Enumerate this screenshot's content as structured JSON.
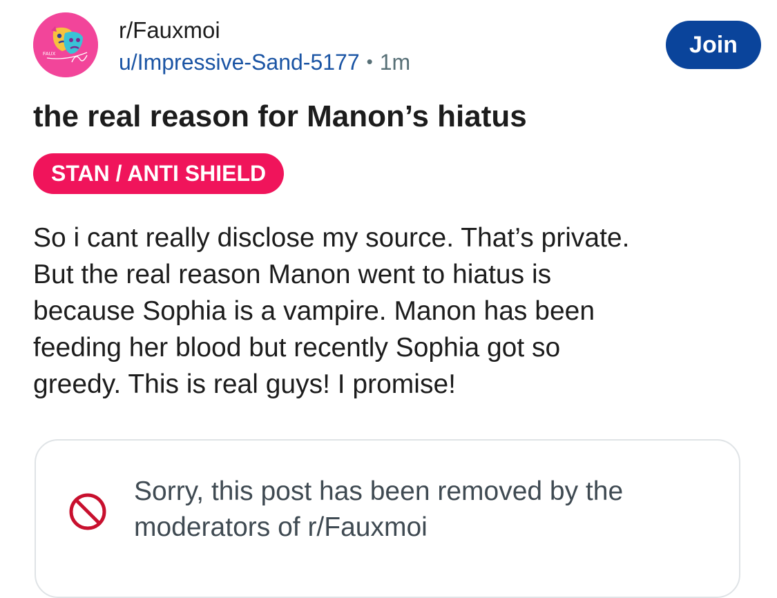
{
  "post": {
    "subreddit": "r/Fauxmoi",
    "username": "u/Impressive-Sand-5177",
    "separator": "•",
    "age": "1m",
    "join_label": "Join",
    "avatar": {
      "icon": "fauxmoi-theater-masks-logo",
      "background_color": "#f2459a",
      "logo_text": "FAUX"
    },
    "title": "the real reason for Manon’s hiatus",
    "flair": {
      "label": "STAN / ANTI SHIELD",
      "color": "#f0145b"
    },
    "body_lines": [
      "So i cant really disclose my source. That’s private.",
      "But the real reason Manon went to hiatus is",
      "because Sophia is a vampire. Manon has been",
      "feeding her blood but recently Sophia got so",
      "greedy. This is real guys! I promise!"
    ],
    "removed_notice": {
      "icon": "prohibited-icon",
      "lines": [
        "Sorry, this post has been removed by the",
        "moderators of r/Fauxmoi"
      ]
    }
  },
  "colors": {
    "join_button": "#0a449b",
    "username": "#1a54a4",
    "removed_icon": "#c8102e"
  }
}
